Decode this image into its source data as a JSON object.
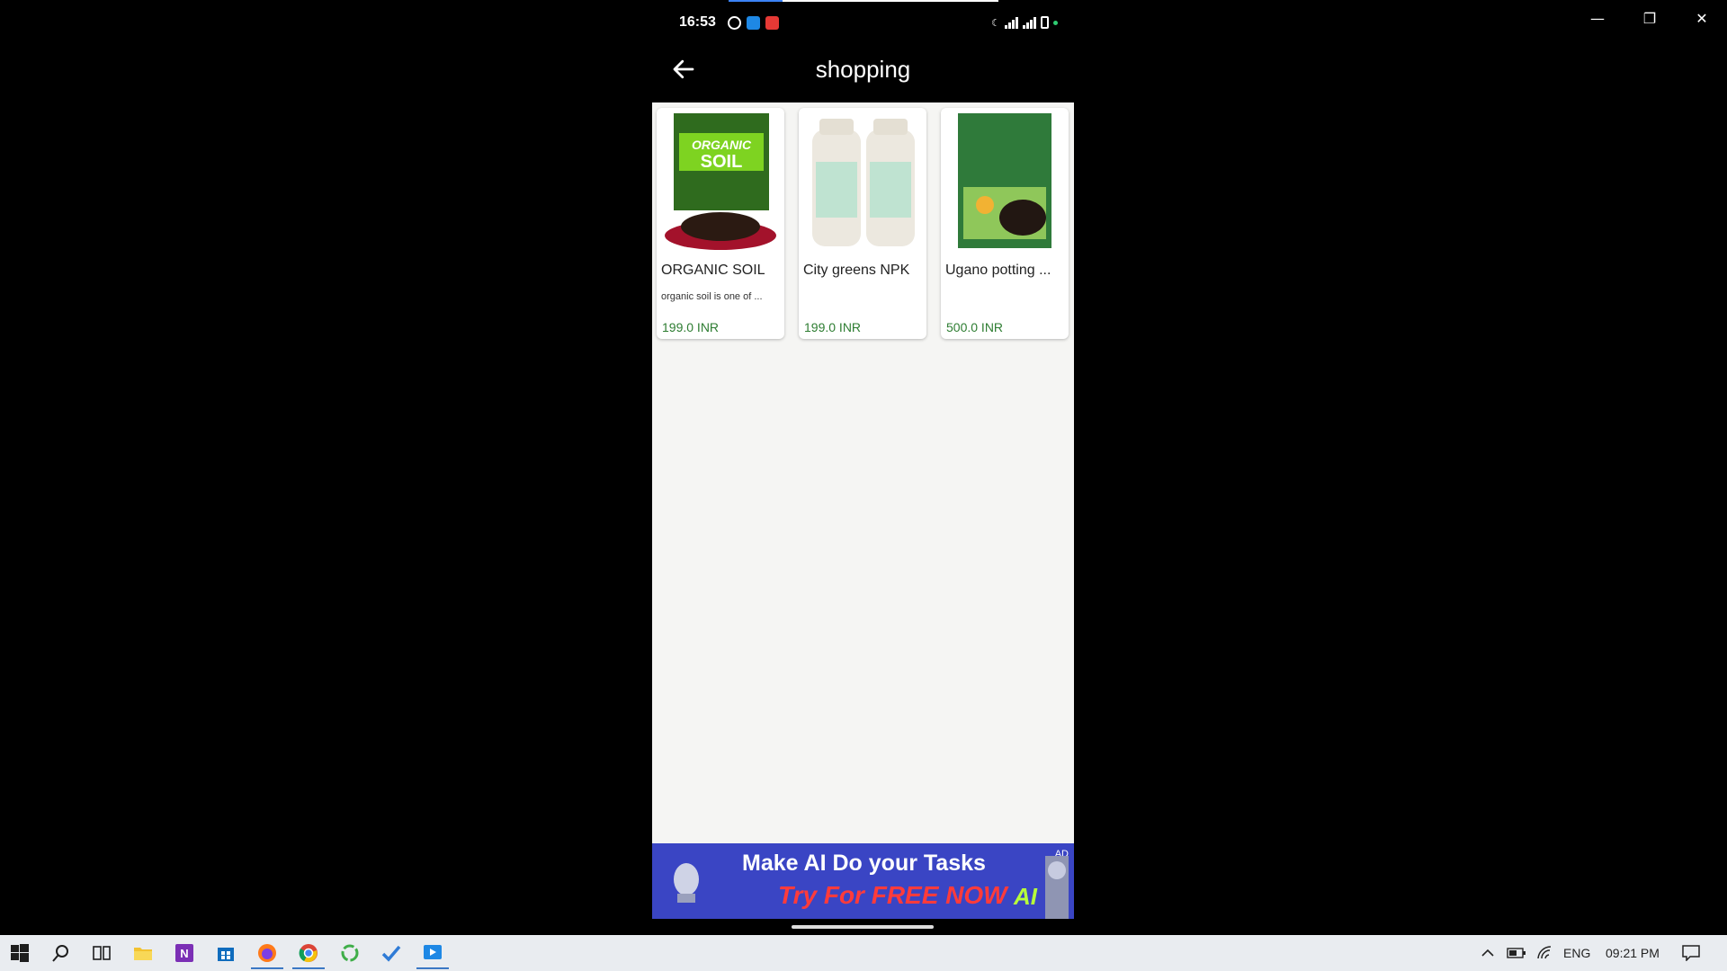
{
  "window_controls": {
    "minimize": "—",
    "maximize": "❐",
    "close": "✕"
  },
  "phone": {
    "status_bar": {
      "time": "16:53"
    },
    "header": {
      "title": "shopping"
    },
    "products": [
      {
        "name": "ORGANIC SOIL",
        "description": "organic soil is one of ...",
        "price": "199.0 INR"
      },
      {
        "name": "City greens NPK",
        "description": "",
        "price": "199.0 INR"
      },
      {
        "name": "Ugano potting ...",
        "description": "",
        "price": "500.0 INR"
      }
    ],
    "ad": {
      "line1": "Make  AI Do your Tasks",
      "line2": "Try For FREE NOW",
      "tag": "AD",
      "ai_badge": "AI"
    }
  },
  "taskbar": {
    "language": "ENG",
    "clock": "09:21 PM"
  },
  "colors": {
    "price_green": "#2e7d32",
    "ad_blue": "#3a45c4",
    "ad_red": "#ff3b3b"
  }
}
